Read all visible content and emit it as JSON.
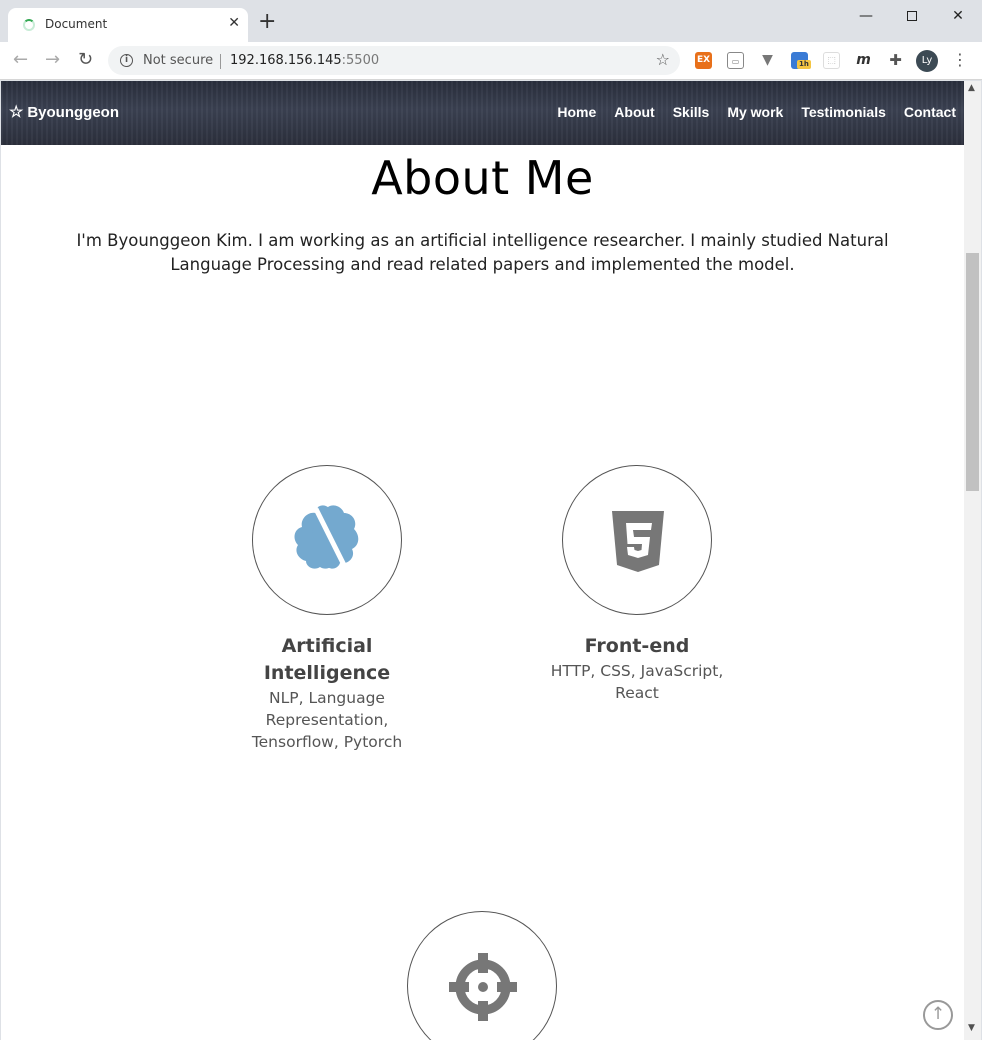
{
  "browser": {
    "tab_title": "Document",
    "tab_close": "✕",
    "new_tab": "+",
    "not_secure": "Not secure",
    "url_host": "192.168.156.145",
    "url_port": ":5500",
    "profile_initials": "Ly",
    "extensions": [
      "EX",
      "▭",
      "▼",
      "1h",
      "⬚",
      "m",
      "✚"
    ]
  },
  "site": {
    "brand": "Byounggeon",
    "menu": [
      "Home",
      "About",
      "Skills",
      "My work",
      "Testimonials",
      "Contact"
    ]
  },
  "about": {
    "title": "About Me",
    "text": "I'm Byounggeon Kim. I am working as an artificial intelligence researcher. I mainly studied Natural Language Processing and read related papers and implemented the model."
  },
  "skills": [
    {
      "icon": "brain-icon",
      "color": "#74a9cf",
      "name": "Artificial Intelligence",
      "desc": "NLP, Language Representation, Tensorflow, Pytorch"
    },
    {
      "icon": "html5-icon",
      "color": "#777777",
      "name": "Front-end",
      "desc": "HTTP, CSS, JavaScript, React"
    },
    {
      "icon": "crosshairs-icon",
      "color": "#777777"
    }
  ]
}
